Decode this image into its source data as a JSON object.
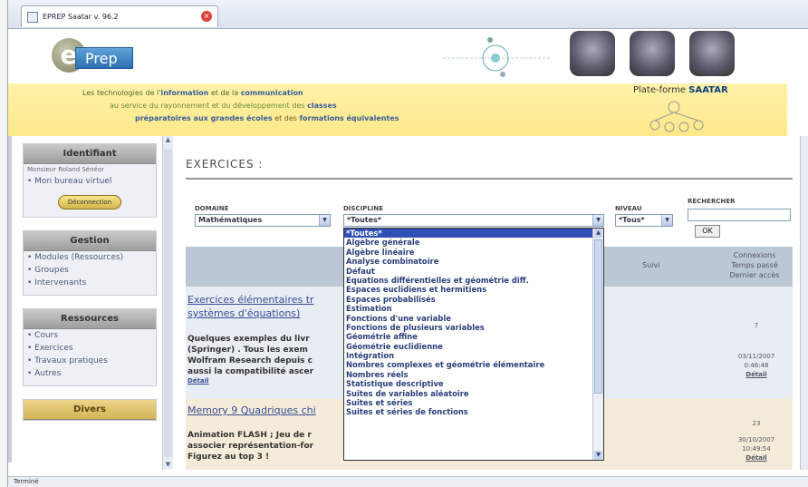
{
  "browser": {
    "tab_title": "EPREP Saatar v. 96.2",
    "status_text": "Terminé"
  },
  "header": {
    "logo_letter": "e",
    "logo_text": "Prep",
    "banner_line1": [
      {
        "t": "Les technologies ",
        "b": false
      },
      {
        "t": "de l'",
        "b": false
      },
      {
        "t": "information",
        "b": true
      },
      {
        "t": " et de la ",
        "b": false
      },
      {
        "t": "communication",
        "b": true
      }
    ],
    "banner_line2": [
      {
        "t": "au service du rayonnement et du développement des ",
        "b": false
      },
      {
        "t": "classes",
        "b": true
      }
    ],
    "banner_line3": [
      {
        "t": "préparatoires aux grandes écoles",
        "b": true
      },
      {
        "t": " et des ",
        "b": false
      },
      {
        "t": "formations équivalentes",
        "b": true
      }
    ],
    "platform_prefix": "Plate-forme ",
    "platform_name": "SAATAR"
  },
  "sidebar": {
    "identifiant": {
      "title": "Identifiant",
      "user": "Monsieur Roland Sénéor",
      "items": [
        "• Mon bureau virtuel"
      ],
      "button": "Déconnection"
    },
    "gestion": {
      "title": "Gestion",
      "items": [
        "• Modules (Ressources)",
        "• Groupes",
        "• Intervenants"
      ]
    },
    "ressources": {
      "title": "Ressources",
      "items": [
        "• Cours",
        "• Exercices",
        "• Travaux pratiques",
        "• Autres"
      ]
    },
    "divers": {
      "title": "Divers"
    }
  },
  "main": {
    "title": "EXERCICES :",
    "filters": {
      "domaine_label": "DOMAINE",
      "domaine_value": "Mathématiques",
      "discipline_label": "DISCIPLINE",
      "discipline_value": "*Toutes*",
      "niveau_label": "NIVEAU",
      "niveau_value": "*Tous*",
      "search_label": "RECHERCHER",
      "search_value": "",
      "ok_label": "OK"
    },
    "table_header": {
      "suivi": "Suivi",
      "stats_l1": "Connexions",
      "stats_l2": "Temps passé",
      "stats_l3": "Dernier accès"
    },
    "rows": [
      {
        "title_l1": "Exercices élémentaires tr",
        "title_l2": "systèmes d'équations)",
        "desc": [
          "Quelques exemples du livr",
          "(Springer) . Tous les exem",
          "Wolfram Research depuis c",
          "aussi la compatibilité ascer"
        ],
        "detail": "Détail",
        "connexions": "7",
        "temps": "03/11/2007",
        "temps2": "0:46:48",
        "stat_detail": "Détail"
      },
      {
        "title_l1": "Memory 9 Quadriques chi",
        "desc": [
          "Animation FLASH ; Jeu de r",
          "associer représentation-for",
          "Figurez au top 3 !"
        ],
        "connexions": "23",
        "temps": "30/10/2007",
        "temps2": "10:49:54",
        "stat_detail": "Détail"
      }
    ],
    "discipline_options": [
      "*Toutes*",
      "Algèbre générale",
      "Algèbre linéaire",
      "Analyse combinatoire",
      "Défaut",
      "Equations différentielles et géométrie diff.",
      "Espaces euclidiens et hermitiens",
      "Espaces probabilisés",
      "Estimation",
      "Fonctions d'une variable",
      "Fonctions de plusieurs variables",
      "Géométrie affine",
      "Géométrie euclidienne",
      "Intégration",
      "Nombres complexes et géométrie élémentaire",
      "Nombres réels",
      "Statistique descriptive",
      "Suites de variables aléatoire",
      "Suites et séries",
      "Suites et séries de fonctions"
    ]
  },
  "icons": {
    "scroll_up": "▲",
    "scroll_down": "▼",
    "dropdown": "▼",
    "close": "×"
  }
}
